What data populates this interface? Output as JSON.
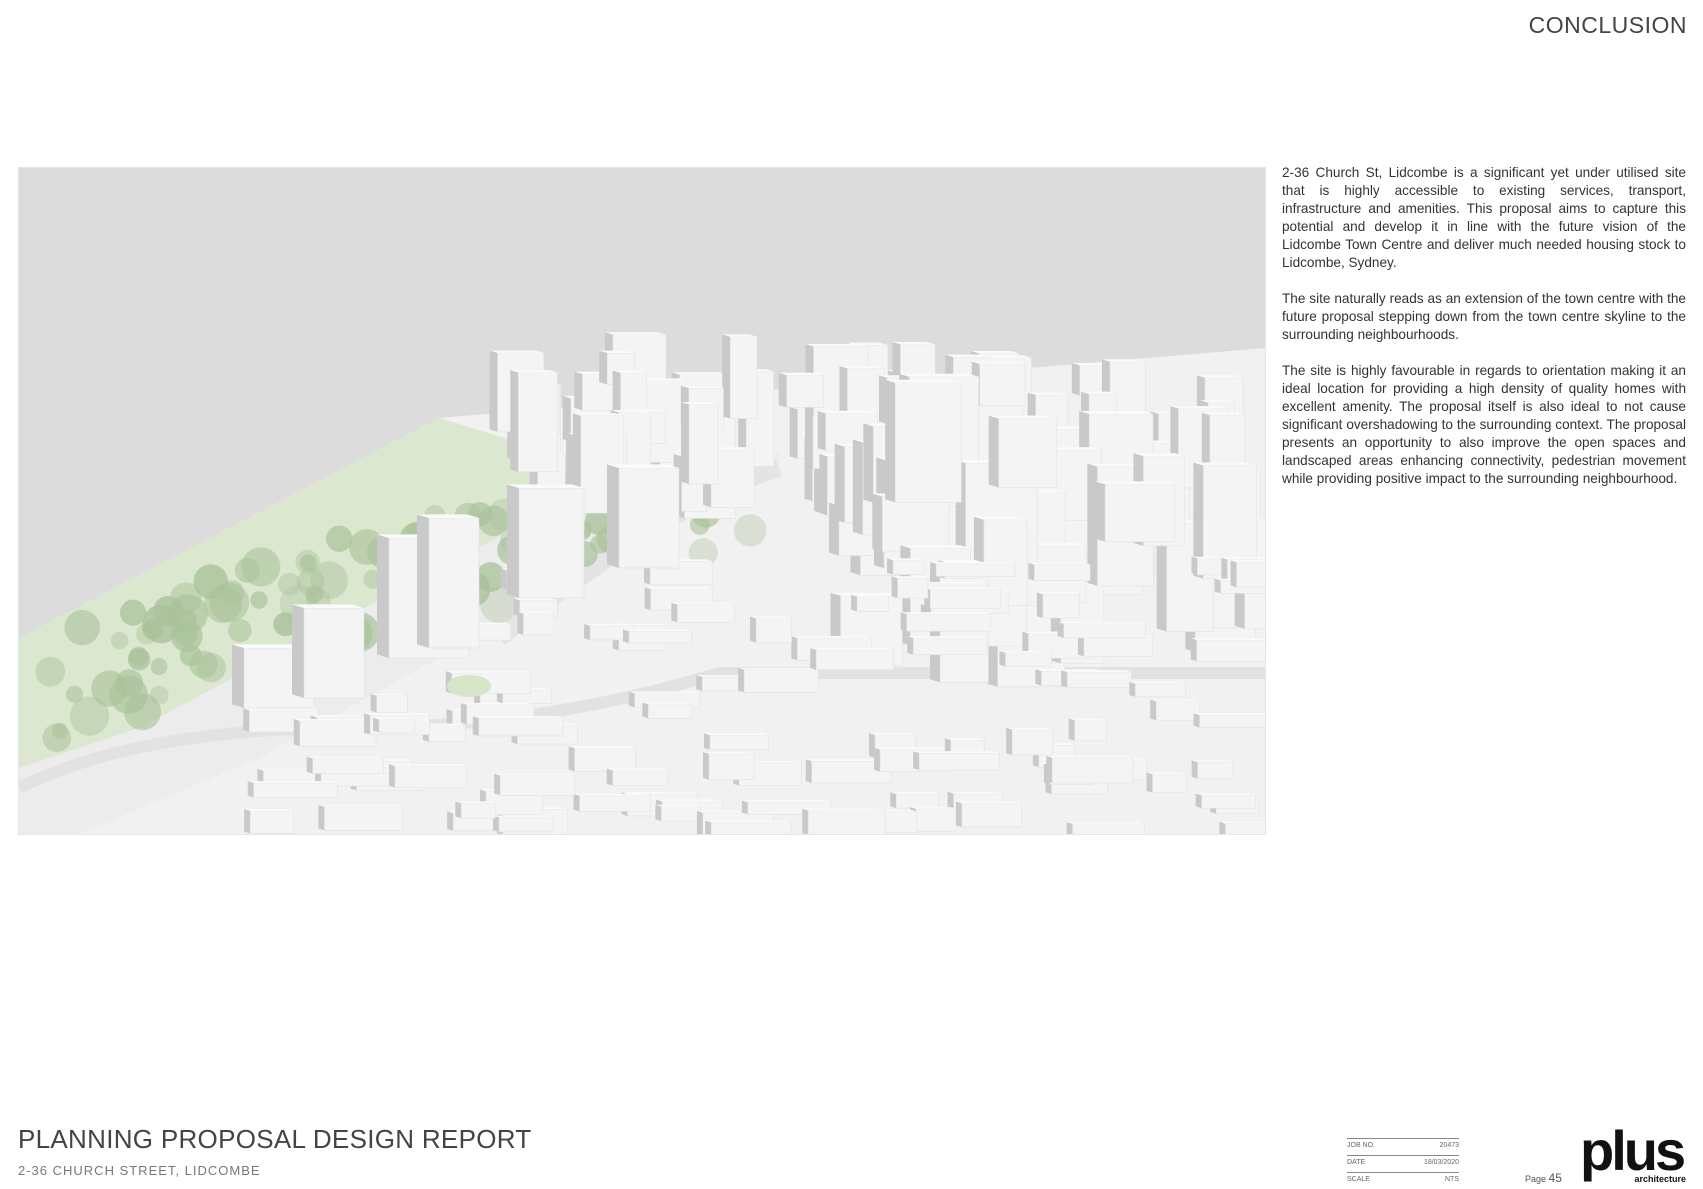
{
  "header": {
    "section_title": "CONCLUSION"
  },
  "main": {
    "paragraphs": [
      "2-36 Church St, Lidcombe is a significant yet under utilised site that is highly accessible to existing services, transport, infrastructure and amenities. This proposal aims to capture this potential and develop it in line with the future vision of the Lidcombe Town Centre and deliver much needed housing stock to Lidcombe, Sydney.",
      "The site naturally reads as an extension of the town centre with the future proposal stepping down from the town centre skyline to the surrounding neighbourhoods.",
      "The site is highly favourable in regards to orientation making it an ideal location for providing a high density of quality homes with excellent amenity. The proposal itself is also ideal to not cause significant overshadowing to the surrounding context. The proposal presents an opportunity to also improve the open spaces and landscaped areas enhancing connectivity, pedestrian movement while providing positive impact to the surrounding neighbourhood."
    ]
  },
  "footer": {
    "report_title": "PLANNING PROPOSAL DESIGN REPORT",
    "report_subtitle": "2-36 CHURCH STREET, LIDCOMBE",
    "info": [
      {
        "label": "JOB NO.",
        "value": "20473"
      },
      {
        "label": "DATE",
        "value": "18/03/2020"
      },
      {
        "label": "SCALE",
        "value": "NTS"
      }
    ],
    "page_label": "Page",
    "page_number": "45",
    "logo_word": "plus",
    "logo_tag": "architecture"
  },
  "colors": {
    "sky": "#dcdcdc",
    "ground": "#f2f2f2",
    "park": "#d9e6cc",
    "building": "#f4f4f4",
    "building_shade": "#c9c9c9",
    "tree": "#a9c29a"
  }
}
